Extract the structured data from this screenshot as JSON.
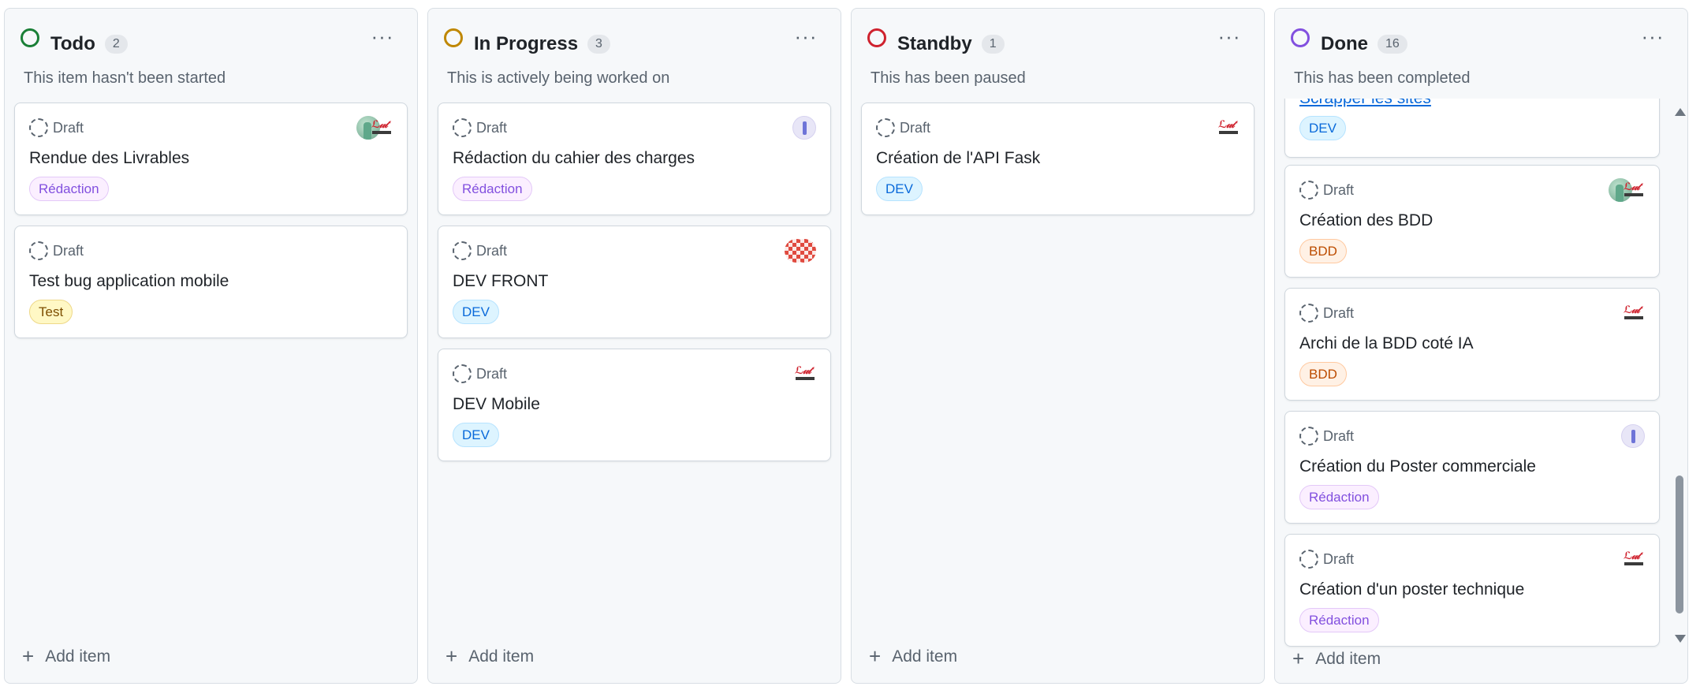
{
  "board": {
    "columns": [
      {
        "title": "Todo",
        "count": "2",
        "description": "This item hasn't been started",
        "status_color": "#1a7f37",
        "add_label": "Add item",
        "cards": [
          {
            "status": "Draft",
            "title": "Rendue des Livrables",
            "tag": "Rédaction",
            "avatar": "people-logo"
          },
          {
            "status": "Draft",
            "title": "Test bug application mobile",
            "tag": "Test",
            "avatar": "none"
          }
        ]
      },
      {
        "title": "In Progress",
        "count": "3",
        "description": "This is actively being worked on",
        "status_color": "#bf8700",
        "add_label": "Add item",
        "cards": [
          {
            "status": "Draft",
            "title": "Rédaction du cahier des charges",
            "tag": "Rédaction",
            "avatar": "purple-identicon"
          },
          {
            "status": "Draft",
            "title": "DEV FRONT",
            "tag": "DEV",
            "avatar": "checker-identicon"
          },
          {
            "status": "Draft",
            "title": "DEV Mobile",
            "tag": "DEV",
            "avatar": "red-logo"
          }
        ]
      },
      {
        "title": "Standby",
        "count": "1",
        "description": "This has been paused",
        "status_color": "#cf222e",
        "add_label": "Add item",
        "cards": [
          {
            "status": "Draft",
            "title": "Création de l'API Fask",
            "tag": "DEV",
            "avatar": "red-logo"
          }
        ]
      },
      {
        "title": "Done",
        "count": "16",
        "description": "This has been completed",
        "status_color": "#8250df",
        "add_label": "Add item",
        "cards": [
          {
            "status": "",
            "title": "Scrapper les sites",
            "tag": "DEV",
            "avatar": "none",
            "is_link": true
          },
          {
            "status": "Draft",
            "title": "Création des BDD",
            "tag": "BDD",
            "avatar": "people-logo"
          },
          {
            "status": "Draft",
            "title": "Archi de la BDD coté IA",
            "tag": "BDD",
            "avatar": "red-logo"
          },
          {
            "status": "Draft",
            "title": "Création du Poster commerciale",
            "tag": "Rédaction",
            "avatar": "purple-identicon"
          },
          {
            "status": "Draft",
            "title": "Création d'un poster technique",
            "tag": "Rédaction",
            "avatar": "red-logo"
          }
        ]
      }
    ]
  },
  "icons": {
    "column_menu": "more-horizontal-icon",
    "draft_status": "dashed-circle-icon",
    "add": "plus-icon",
    "column_status": "circle-icon"
  },
  "tag_colors": {
    "Rédaction": "#8250df",
    "DEV": "#0969da",
    "Test": "#7d4e00",
    "BDD": "#bc4c00"
  }
}
